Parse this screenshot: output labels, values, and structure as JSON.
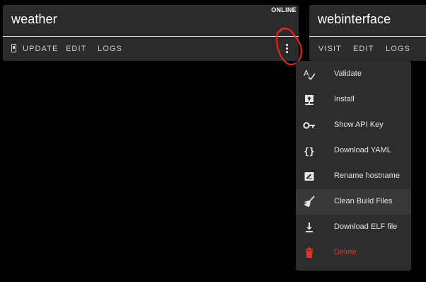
{
  "cards": [
    {
      "title": "weather",
      "status": "ONLINE",
      "actions": [
        "UPDATE",
        "EDIT",
        "LOGS"
      ]
    },
    {
      "title": "webinterface",
      "actions": [
        "VISIT",
        "EDIT",
        "LOGS"
      ]
    }
  ],
  "menu": {
    "items": [
      {
        "label": "Validate",
        "icon": "spellcheck-icon"
      },
      {
        "label": "Install",
        "icon": "upload-icon"
      },
      {
        "label": "Show API Key",
        "icon": "key-icon"
      },
      {
        "label": "Download YAML",
        "icon": "code-braces-icon"
      },
      {
        "label": "Rename hostname",
        "icon": "rename-icon"
      },
      {
        "label": "Clean Build Files",
        "icon": "broom-icon"
      },
      {
        "label": "Download ELF file",
        "icon": "download-icon"
      },
      {
        "label": "Delete",
        "icon": "delete-icon"
      }
    ],
    "highlighted_index": 5
  },
  "colors": {
    "background": "#000000",
    "card": "#2b2b2b",
    "menu": "#2d2d2d",
    "danger": "#e0342b",
    "annotation": "#e8231b"
  }
}
